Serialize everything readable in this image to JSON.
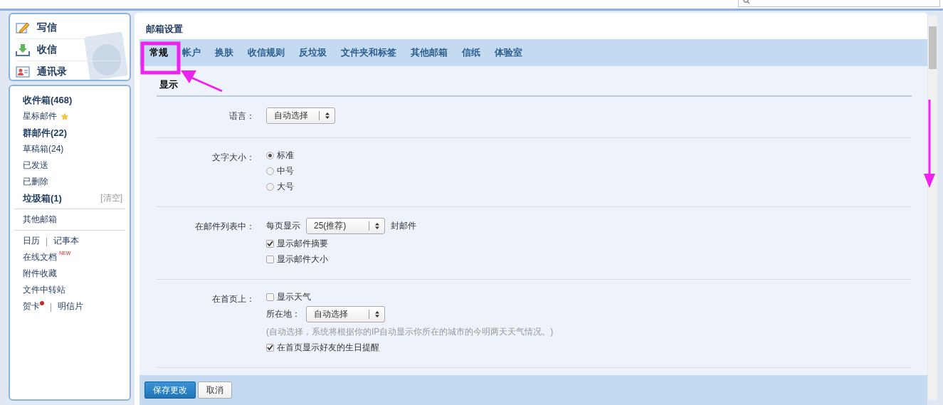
{
  "sidebar": {
    "actions": [
      {
        "label": "写信",
        "kind": "compose"
      },
      {
        "label": "收信",
        "kind": "receive"
      },
      {
        "label": "通讯录",
        "kind": "contacts"
      }
    ],
    "folders": [
      {
        "label": "收件箱(468)",
        "unread": true
      },
      {
        "label": "星标邮件",
        "unread": false,
        "starred": true
      },
      {
        "label": "群邮件(22)",
        "unread": true
      },
      {
        "label": "草稿箱(24)",
        "unread": false
      },
      {
        "label": "已发送",
        "unread": false
      },
      {
        "label": "已删除",
        "unread": false
      },
      {
        "label": "垃圾箱(1)",
        "unread": true,
        "action": "[清空]"
      }
    ],
    "other": [
      "其他邮箱"
    ],
    "tools": [
      {
        "items": [
          {
            "label": "日历"
          },
          {
            "label": "记事本"
          }
        ],
        "separator": "|"
      },
      {
        "items": [
          {
            "label": "在线文档",
            "badge": "NEW"
          }
        ]
      },
      {
        "items": [
          {
            "label": "附件收藏"
          }
        ]
      },
      {
        "items": [
          {
            "label": "文件中转站"
          }
        ]
      },
      {
        "items": [
          {
            "label": "贺卡",
            "dot": true
          },
          {
            "label": "明信片"
          }
        ],
        "separator": "|"
      }
    ]
  },
  "page": {
    "title": "邮箱设置",
    "tabs": [
      {
        "label": "常规",
        "selected": true
      },
      {
        "label": "帐户",
        "selected": false
      },
      {
        "label": "换肤",
        "selected": false
      },
      {
        "label": "收信规则",
        "selected": false
      },
      {
        "label": "反垃圾",
        "selected": false
      },
      {
        "label": "文件夹和标签",
        "selected": false
      },
      {
        "label": "其他邮箱",
        "selected": false
      },
      {
        "label": "信纸",
        "selected": false
      },
      {
        "label": "体验室",
        "selected": false
      }
    ],
    "section": "显示",
    "settings": [
      {
        "label": "语言：",
        "controls": [
          {
            "kind": "select",
            "value": "自动选择"
          }
        ]
      },
      {
        "label": "文字大小：",
        "controls": [
          {
            "kind": "radio",
            "label": "标准",
            "selected": true
          },
          {
            "kind": "radio",
            "label": "中号",
            "selected": false
          },
          {
            "kind": "radio",
            "label": "大号",
            "selected": false
          }
        ]
      },
      {
        "label": "在邮件列表中：",
        "controls": [
          {
            "kind": "inline",
            "prefix": "每页显示",
            "value": "25(推荐)",
            "suffix": "封邮件"
          },
          {
            "kind": "checkbox",
            "label": "显示邮件摘要",
            "checked": true
          },
          {
            "kind": "checkbox",
            "label": "显示邮件大小",
            "checked": false
          }
        ]
      },
      {
        "label": "在首页上：",
        "controls": [
          {
            "kind": "checkbox",
            "label": "显示天气",
            "checked": false
          },
          {
            "kind": "inline",
            "prefix": "所在地：",
            "value": "自动选择"
          },
          {
            "kind": "note",
            "text": "(自动选择，系统将根据你的IP自动显示你所在的城市的今明两天天气情况。)"
          },
          {
            "kind": "checkbox",
            "label": "在首页显示好友的生日提醒",
            "checked": true
          }
        ]
      }
    ],
    "buttons": [
      {
        "label": "保存更改",
        "kind": "primary"
      },
      {
        "label": "取消",
        "kind": "default"
      }
    ]
  }
}
